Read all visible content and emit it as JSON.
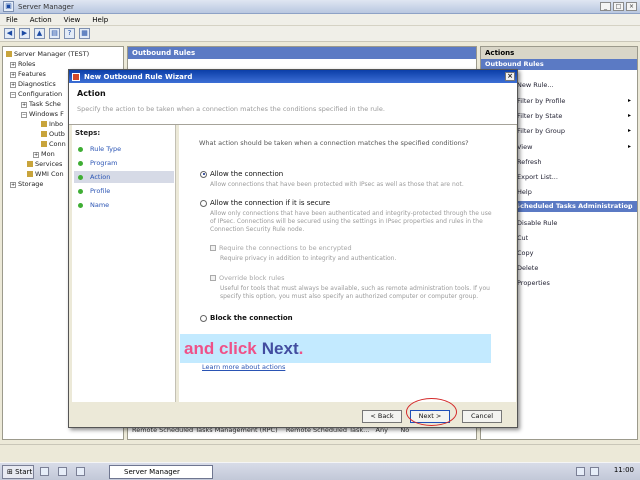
{
  "server_manager": {
    "title": "Server Manager",
    "menu": [
      "File",
      "Action",
      "View",
      "Help"
    ],
    "tree": [
      {
        "label": "Server Manager (TEST)"
      },
      {
        "label": "Roles"
      },
      {
        "label": "Features"
      },
      {
        "label": "Diagnostics"
      },
      {
        "label": "Configuration"
      },
      {
        "label": "Task Sche"
      },
      {
        "label": "Windows F"
      },
      {
        "label": "Inbo"
      },
      {
        "label": "Outb"
      },
      {
        "label": "Conn"
      },
      {
        "label": "Mon"
      },
      {
        "label": "Services"
      },
      {
        "label": "WMI Con"
      },
      {
        "label": "Storage"
      }
    ],
    "center_header": "Outbound Rules",
    "center_bottom_row": {
      "name": "Remote Scheduled Tasks Management (RPC)",
      "group": "Remote Scheduled Task...",
      "profile": "Any",
      "enabled": "No"
    },
    "actions_header": "Actions",
    "actions_section1": "Outbound Rules",
    "actions_items": [
      "New Rule...",
      "Filter by Profile",
      "Filter by State",
      "Filter by Group",
      "View",
      "Refresh",
      "Export List...",
      "Help"
    ],
    "actions_section2": "Remote Scheduled Tasks Administration (RPC-In)",
    "actions_items2": [
      "Disable Rule",
      "Cut",
      "Copy",
      "Delete",
      "Properties"
    ]
  },
  "wizard": {
    "title": "New Outbound Rule Wizard",
    "heading": "Action",
    "subtitle": "Specify the action to be taken when a connection matches the conditions specified in the rule.",
    "steps_title": "Steps:",
    "steps": [
      "Rule Type",
      "Program",
      "Action",
      "Profile",
      "Name"
    ],
    "active_step": "Action",
    "question": "What action should be taken when a connection matches the specified conditions?",
    "options": {
      "allow": {
        "label": "Allow the connection",
        "desc": "Allow connections that have been protected with IPsec as well as those that are not.",
        "checked": true
      },
      "allow_secure": {
        "label": "Allow the connection if it is secure",
        "desc": "Allow only connections that have been authenticated and integrity-protected through the use of IPsec. Connections will be secured using the settings in IPsec properties and rules in the Connection Security Rule node.",
        "checked": false
      },
      "block": {
        "label": "Block the connection",
        "checked": false
      }
    },
    "require_encryption": {
      "label": "Require the connections to be encrypted",
      "desc": "Require privacy in addition to integrity and authentication."
    },
    "override_block": {
      "label": "Override block rules",
      "desc": "Useful for tools that must always be available, such as remote administration tools. If you specify this option, you must also specify an authorized computer or computer group."
    },
    "learn_more": "Learn more about actions",
    "buttons": {
      "back": "< Back",
      "next": "Next >",
      "cancel": "Cancel"
    }
  },
  "banner": {
    "part1": "and click",
    "part2": "Next",
    "part3": "."
  },
  "taskbar": {
    "start": "Start",
    "task_item": "Server Manager",
    "clock": "11:00"
  }
}
